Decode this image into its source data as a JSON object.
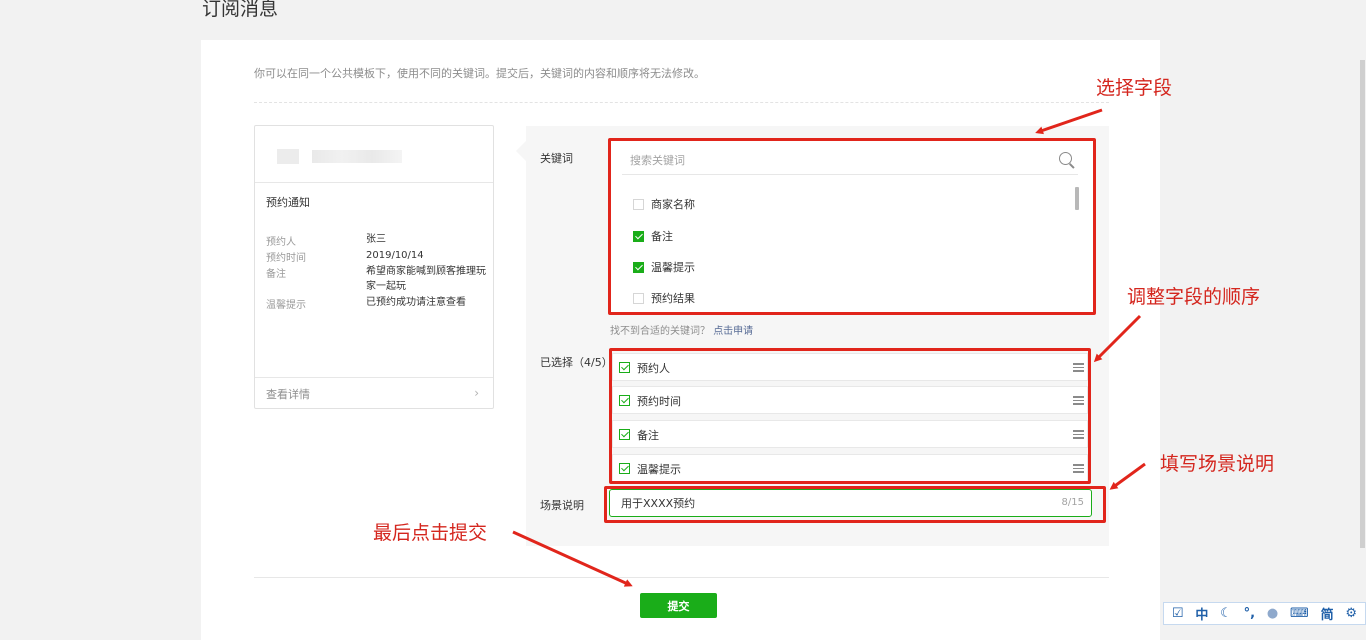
{
  "page": {
    "title": "订阅消息"
  },
  "intro": "你可以在同一个公共模板下，使用不同的关键词。提交后，关键词的内容和顺序将无法修改。",
  "preview": {
    "title": "预约通知",
    "rows": [
      {
        "label": "预约人",
        "value": "张三"
      },
      {
        "label": "预约时间",
        "value": "2019/10/14"
      },
      {
        "label": "备注",
        "value": "希望商家能喊到顾客推理玩家一起玩"
      },
      {
        "label": "温馨提示",
        "value": "已预约成功请注意查看"
      }
    ],
    "footer": "查看详情"
  },
  "keywords": {
    "label": "关键词",
    "search_placeholder": "搜索关键词",
    "options": [
      {
        "label": "商家名称",
        "checked": false
      },
      {
        "label": "备注",
        "checked": true
      },
      {
        "label": "温馨提示",
        "checked": true
      },
      {
        "label": "预约结果",
        "checked": false
      }
    ],
    "help_text": "找不到合适的关键词？",
    "help_link": "点击申请"
  },
  "selected": {
    "label": "已选择（4/5）",
    "items": [
      "预约人",
      "预约时间",
      "备注",
      "温馨提示"
    ]
  },
  "scene": {
    "label": "场景说明",
    "value": "用于XXXX预约",
    "count": "8/15"
  },
  "submit_label": "提交",
  "annotations": {
    "select_fields": "选择字段",
    "reorder": "调整字段的顺序",
    "fill_scene": "填写场景说明",
    "final_submit": "最后点击提交"
  },
  "ime": [
    "中",
    "简"
  ],
  "colors": {
    "brand": "#1aad19",
    "annotation": "#e1251b",
    "link": "#576b95"
  }
}
